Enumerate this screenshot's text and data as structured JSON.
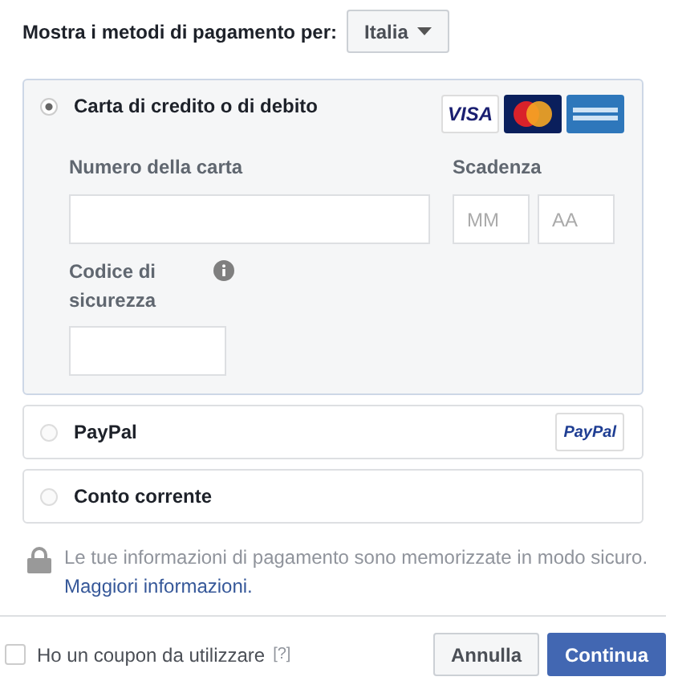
{
  "country_picker": {
    "label": "Mostra i metodi di pagamento per:",
    "value": "Italia"
  },
  "methods": [
    {
      "kind": "card",
      "label": "Carta di credito o di debito",
      "selected": true,
      "logo_text": "VISA",
      "fields": {
        "number_label": "Numero della carta",
        "expiry_label": "Scadenza",
        "month_placeholder": "MM",
        "year_placeholder": "AA",
        "cvv_label": "Codice di sicurezza"
      }
    },
    {
      "kind": "paypal",
      "label": "PayPal",
      "selected": false,
      "logo_text": "PayPal"
    },
    {
      "kind": "bank",
      "label": "Conto corrente",
      "selected": false
    }
  ],
  "security_note": {
    "text": "Le tue informazioni di pagamento sono memorizzate in modo sicuro.",
    "link": "Maggiori informazioni."
  },
  "coupon": {
    "label": "Ho un coupon da utilizzare",
    "help": "[?]",
    "checked": false
  },
  "buttons": [
    {
      "kind": "secondary",
      "label": "Annulla"
    },
    {
      "kind": "primary",
      "label": "Continua"
    }
  ]
}
